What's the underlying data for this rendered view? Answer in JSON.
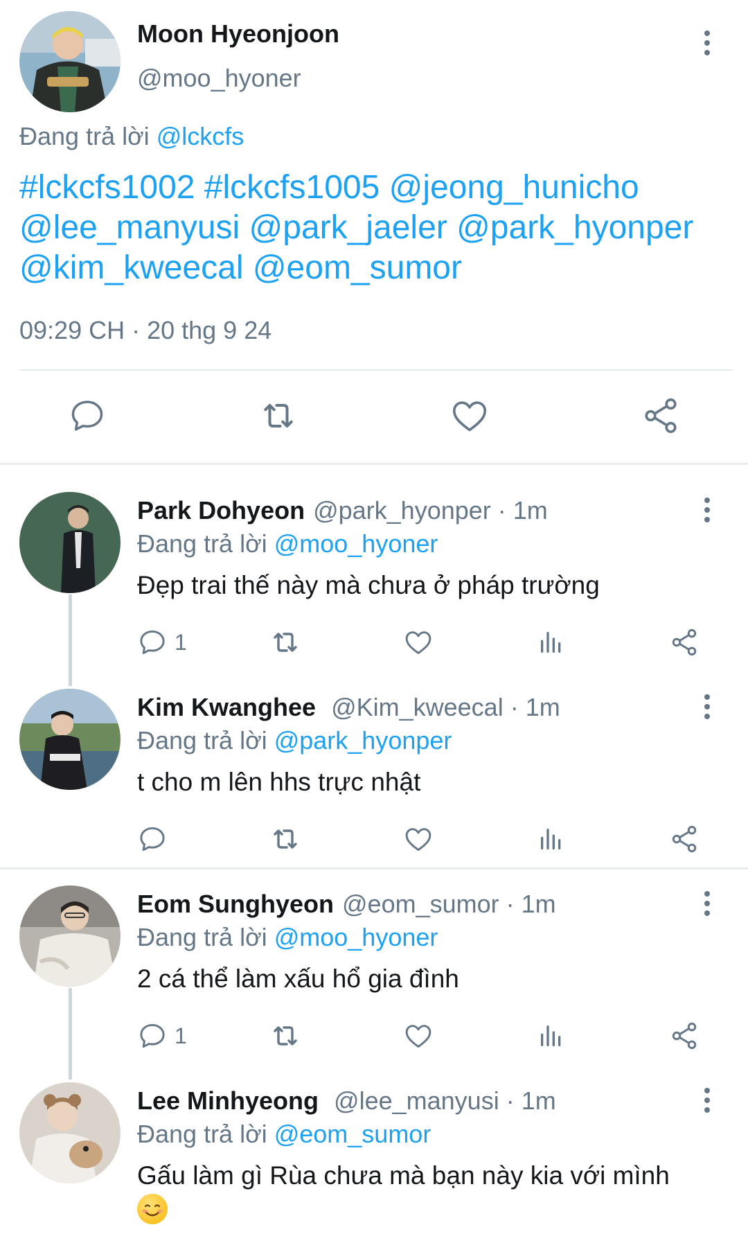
{
  "main_tweet": {
    "name": "Moon Hyeonjoon",
    "handle": "@moo_hyoner",
    "reply_prefix": "Đang trả lời",
    "reply_to": "@lckcfs",
    "body_lines": [
      "#lckcfs1002 #lckcfs1005 @jeong_hunicho",
      "@lee_manyusi @park_jaeler @park_hyonper",
      "@kim_kweecal @eom_sumor"
    ],
    "timestamp": "09:29 CH · 20 thg 9 24",
    "actions": [
      "reply-icon",
      "retweet-icon",
      "like-icon",
      "share-icon"
    ]
  },
  "replies": [
    {
      "name": "Park Dohyeon",
      "handle": "@park_hyonper",
      "time": "· 1m",
      "reply_prefix": "Đang trả lời",
      "reply_to": "@moo_hyoner",
      "text": "Đẹp trai thế này mà chưa ở pháp trường",
      "reply_count": "1"
    },
    {
      "name": "Kim Kwanghee",
      "handle": "@Kim_kweecal",
      "time": "· 1m",
      "reply_prefix": "Đang trả lời",
      "reply_to": "@park_hyonper",
      "text": "t cho m lên hhs trực nhật",
      "reply_count": ""
    },
    {
      "name": "Eom Sunghyeon",
      "handle": "@eom_sumor",
      "time": "· 1m",
      "reply_prefix": "Đang trả lời",
      "reply_to": "@moo_hyoner",
      "text": "2 cá thể làm xấu hổ gia đình",
      "reply_count": "1"
    },
    {
      "name": "Lee Minhyeong",
      "handle": "@lee_manyusi",
      "time": "· 1m",
      "reply_prefix": "Đang trả lời",
      "reply_to": "@eom_sumor",
      "text": "Gấu làm gì Rùa chưa mà bạn này kia với mình",
      "emoji": "☺️",
      "reply_count": ""
    }
  ],
  "colors": {
    "link": "#1da1f2",
    "secondary_text": "#657786",
    "primary_text": "#14171a",
    "divider": "#e6ecf0"
  }
}
